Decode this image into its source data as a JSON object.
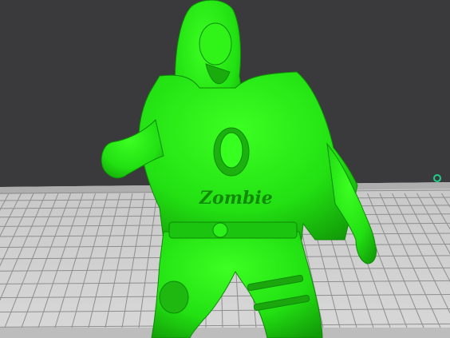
{
  "viewport": {
    "background": "#3a3a3c",
    "model_color": "#22e012",
    "plate_color": "#d3d3d3",
    "grid_color": "#8e8e8e"
  },
  "build_plate": {
    "label_left": "",
    "label_bottom": "",
    "corner_icon": "plate-origin-icon"
  },
  "model": {
    "shirt_text": "Zombie"
  }
}
